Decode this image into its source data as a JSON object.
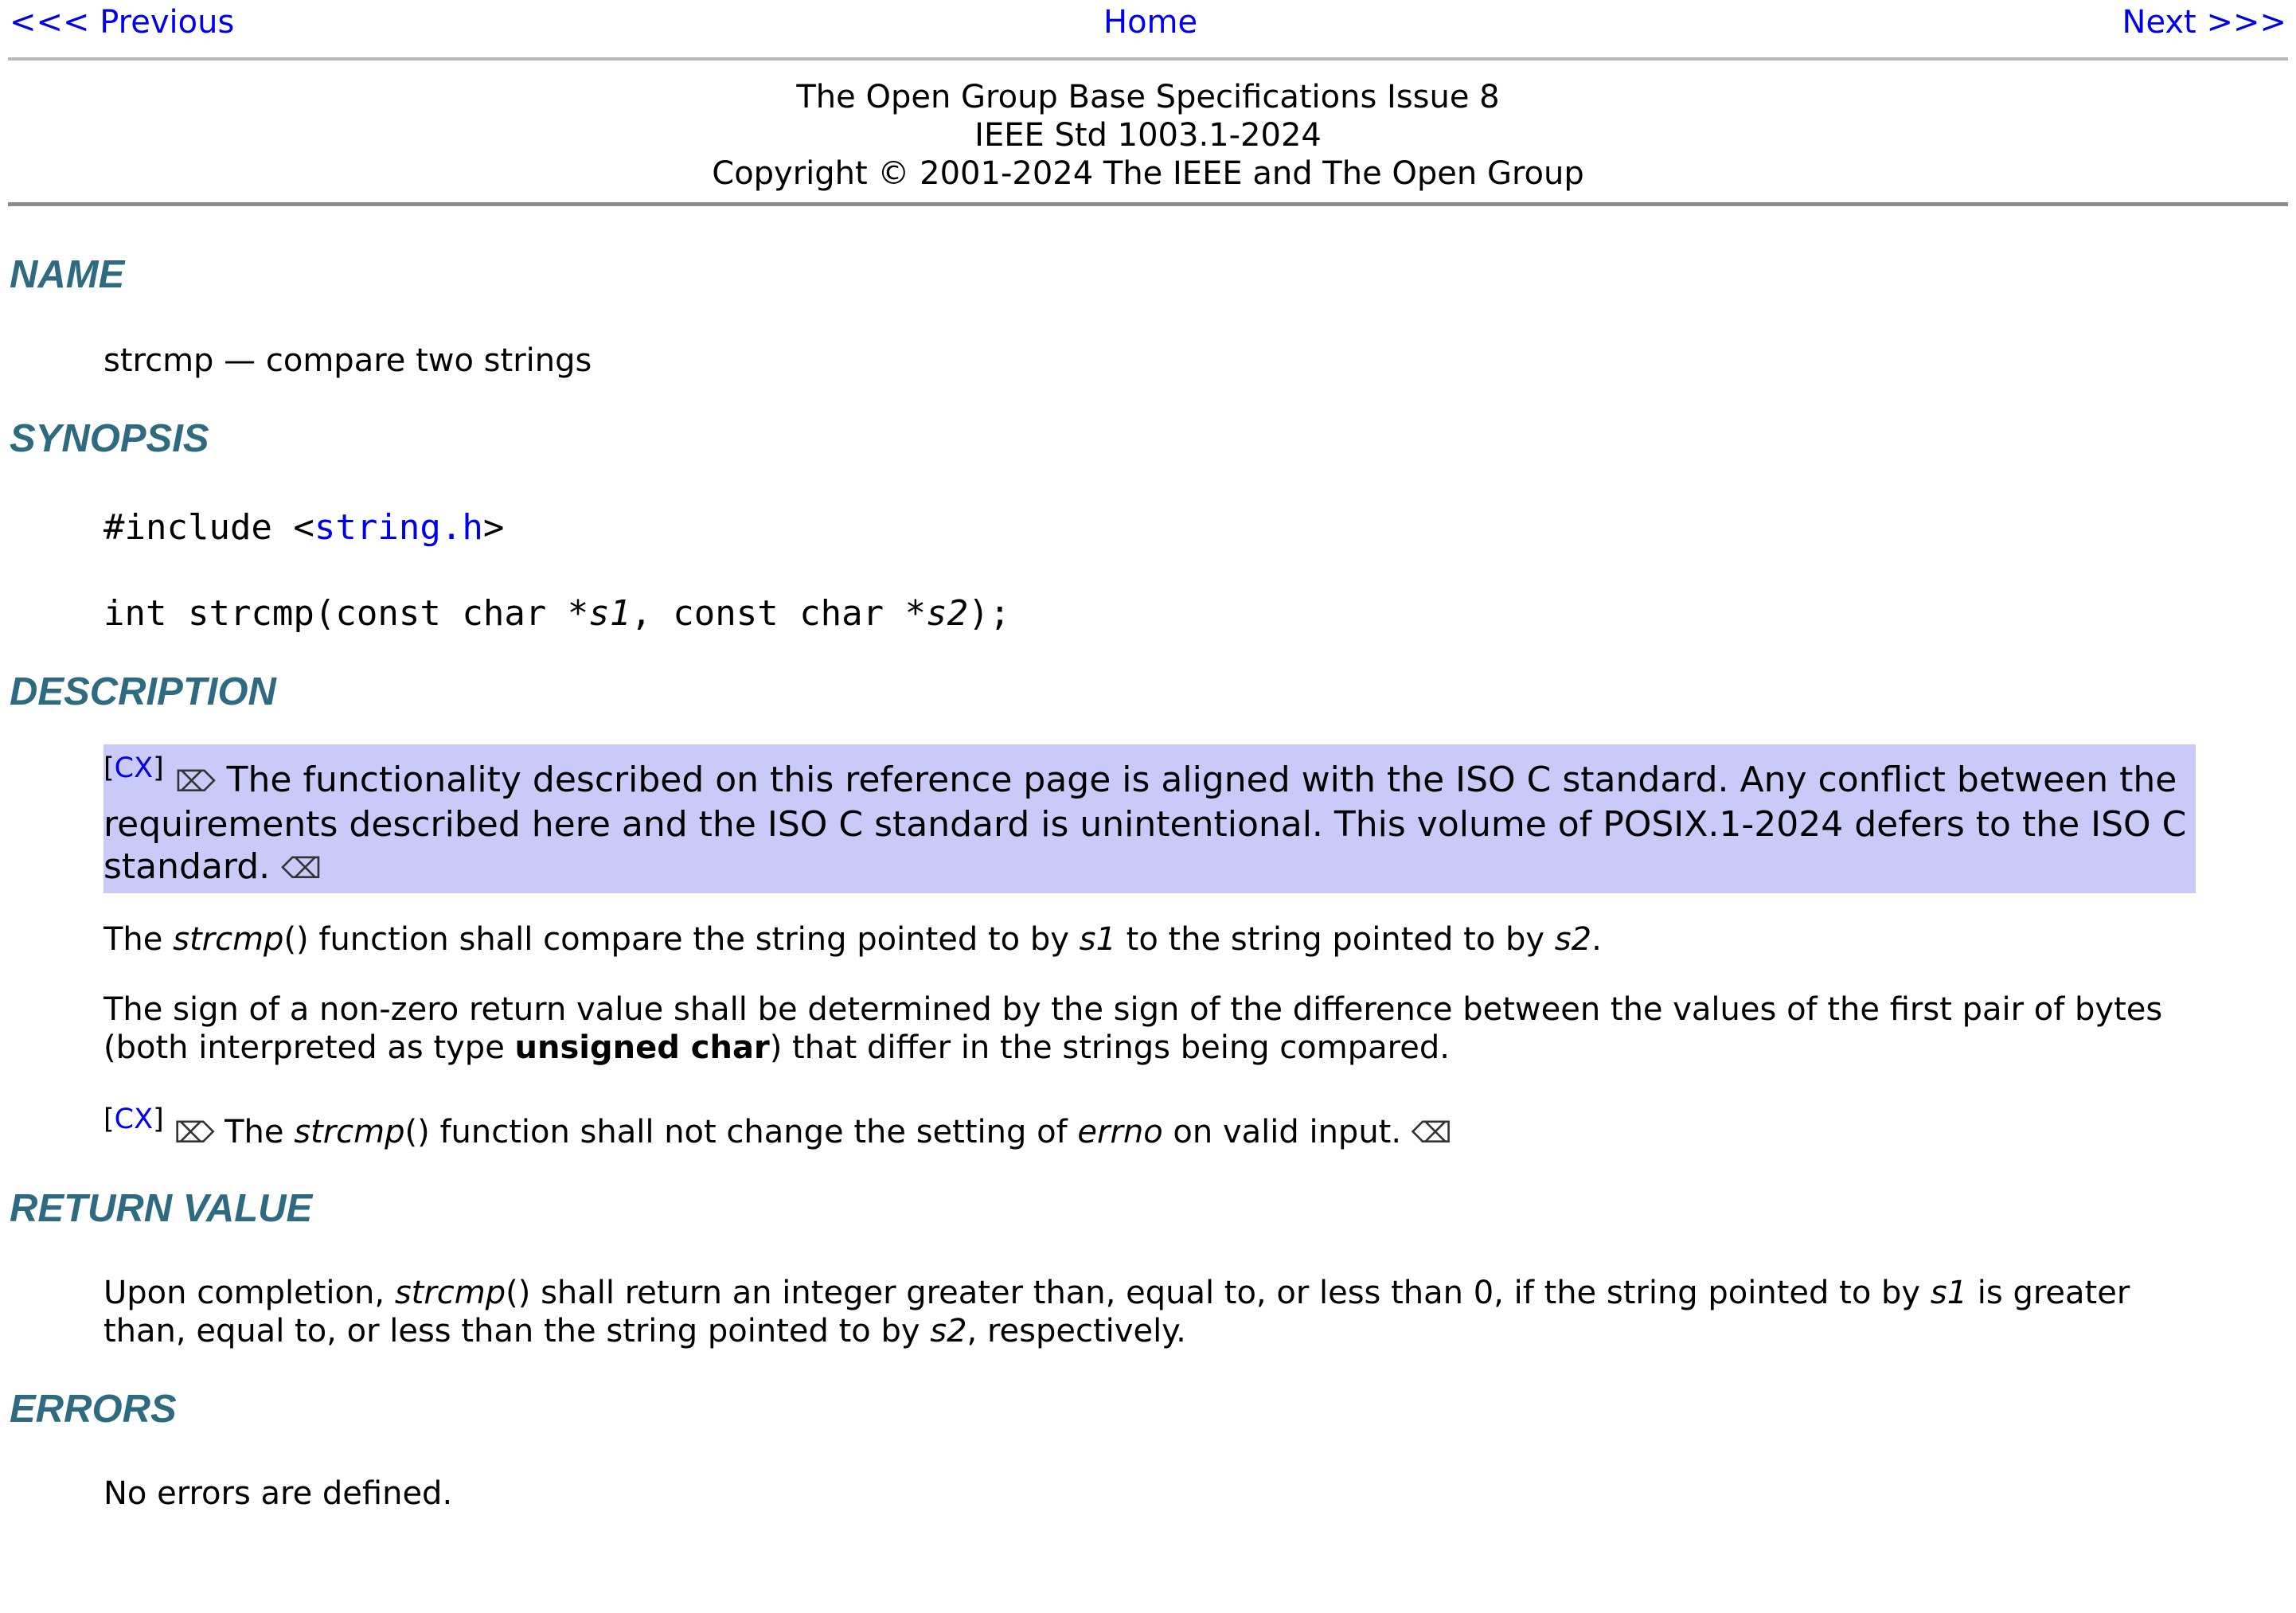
{
  "nav": {
    "previous": "<<< Previous",
    "home": "Home",
    "next": "Next >>>"
  },
  "header": {
    "line1": "The Open Group Base Specifications Issue 8",
    "line2": "IEEE Std 1003.1-2024",
    "line3": "Copyright © 2001-2024 The IEEE and The Open Group"
  },
  "sections": {
    "name": {
      "heading": "NAME",
      "text": "strcmp — compare two strings"
    },
    "synopsis": {
      "heading": "SYNOPSIS",
      "include_prefix": "#include <",
      "include_link": "string.h",
      "include_suffix": ">",
      "proto_a": "int strcmp(const char *",
      "proto_s1": "s1",
      "proto_b": ", const char *",
      "proto_s2": "s2",
      "proto_c": ");"
    },
    "description": {
      "heading": "DESCRIPTION",
      "cx_label": "[CX]",
      "cx_start_mark": "⌦",
      "cx_end_mark": "⌫",
      "cx_text": "The functionality described on this reference page is aligned with the ISO C standard. Any conflict between the requirements described here and the ISO C standard is unintentional. This volume of POSIX.1-2024 defers to the ISO C standard.",
      "p1_a": "The ",
      "p1_func": "strcmp",
      "p1_b": "() function shall compare the string pointed to by ",
      "p1_s1": "s1",
      "p1_c": " to the string pointed to by ",
      "p1_s2": "s2",
      "p1_d": ".",
      "p2_a": "The sign of a non-zero return value shall be determined by the sign of the difference between the values of the first pair of bytes (both interpreted as type ",
      "p2_bold": "unsigned char",
      "p2_b": ") that differ in the strings being compared.",
      "p3_a": " The ",
      "p3_func": "strcmp",
      "p3_b": "() function shall not change the setting of ",
      "p3_errno": "errno",
      "p3_c": " on valid input. "
    },
    "return_value": {
      "heading": "RETURN VALUE",
      "a": "Upon completion, ",
      "func": "strcmp",
      "b": "() shall return an integer greater than, equal to, or less than 0, if the string pointed to by ",
      "s1": "s1",
      "c": " is greater than, equal to, or less than the string pointed to by ",
      "s2": "s2",
      "d": ", respectively."
    },
    "errors": {
      "heading": "ERRORS",
      "text": "No errors are defined."
    }
  }
}
